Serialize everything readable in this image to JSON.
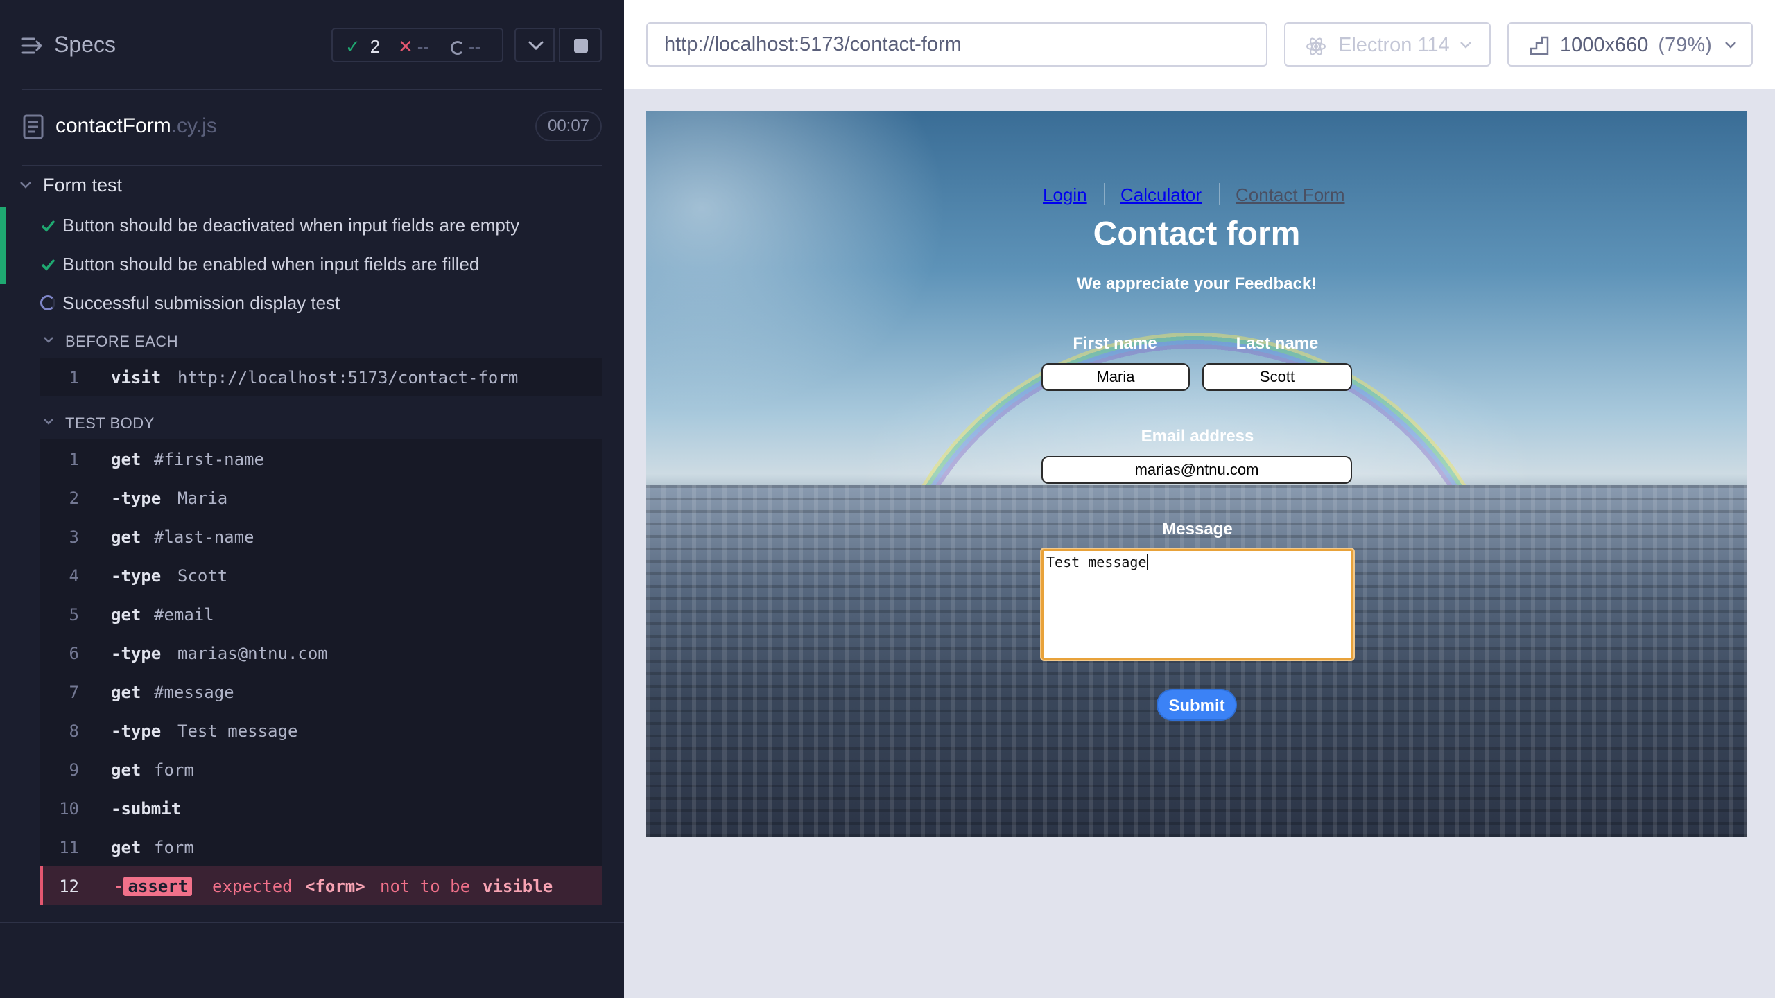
{
  "reporter": {
    "title": "Specs",
    "stats": {
      "passed": "2",
      "failed": "--",
      "pending": "--"
    },
    "spec": {
      "name": "contactForm",
      "ext": ".cy.js",
      "duration": "00:07"
    },
    "suite": "Form test",
    "tests": [
      {
        "label": "Button should be deactivated when input fields are empty",
        "state": "passed"
      },
      {
        "label": "Button should be enabled when input fields are filled",
        "state": "passed"
      },
      {
        "label": "Successful submission display test",
        "state": "pending"
      }
    ],
    "before_each": {
      "label": "BEFORE EACH",
      "commands": [
        {
          "no": "1",
          "name": "visit",
          "arg": "http://localhost:5173/contact-form"
        }
      ]
    },
    "test_body": {
      "label": "TEST BODY",
      "commands": [
        {
          "no": "1",
          "name": "get",
          "arg": "#first-name"
        },
        {
          "no": "2",
          "name": "-type",
          "arg": "Maria"
        },
        {
          "no": "3",
          "name": "get",
          "arg": "#last-name"
        },
        {
          "no": "4",
          "name": "-type",
          "arg": "Scott"
        },
        {
          "no": "5",
          "name": "get",
          "arg": "#email"
        },
        {
          "no": "6",
          "name": "-type",
          "arg": "marias@ntnu.com"
        },
        {
          "no": "7",
          "name": "get",
          "arg": "#message"
        },
        {
          "no": "8",
          "name": "-type",
          "arg": "Test message"
        },
        {
          "no": "9",
          "name": "get",
          "arg": "form"
        },
        {
          "no": "10",
          "name": "-submit",
          "arg": ""
        },
        {
          "no": "11",
          "name": "get",
          "arg": "form"
        }
      ],
      "failed": {
        "no": "12",
        "dash": "-",
        "badge": "assert",
        "w1": "expected",
        "w2": "<form>",
        "w3": "not to be",
        "w4": "visible"
      }
    }
  },
  "toolbar": {
    "url": "http://localhost:5173/contact-form",
    "browser": "Electron 114",
    "viewport": "1000x660",
    "zoom": "(79%)"
  },
  "app": {
    "nav": [
      "Login",
      "Calculator",
      "Contact Form"
    ],
    "title": "Contact form",
    "subtitle": "We appreciate your Feedback!",
    "first_name_label": "First name",
    "last_name_label": "Last name",
    "first_name": "Maria",
    "last_name": "Scott",
    "email_label": "Email address",
    "email": "marias@ntnu.com",
    "message_label": "Message",
    "message": "Test message",
    "submit": "Submit"
  },
  "colors": {
    "pass": "#1fa971",
    "fail": "#e45770",
    "accent": "#3b82f6"
  }
}
